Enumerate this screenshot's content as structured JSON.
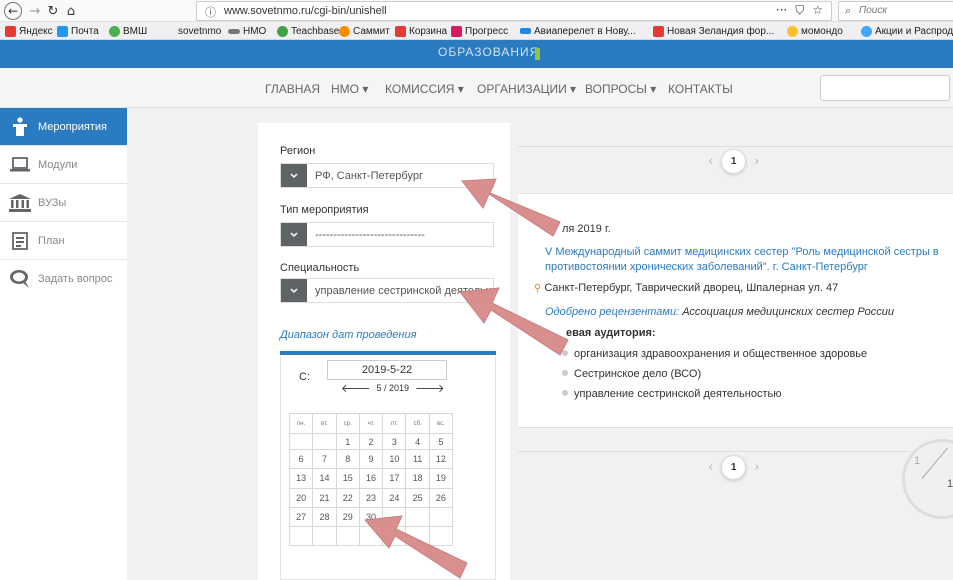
{
  "browser": {
    "url": "www.sovetnmo.ru/cgi-bin/unishell",
    "search_placeholder": "Поиск",
    "url_more": "···",
    "bookmarks": [
      {
        "label": "Яндекс",
        "color": "#e53935"
      },
      {
        "label": "Почта",
        "color": "#2196f3"
      },
      {
        "label": "ВМШ",
        "color": "#4caf50"
      },
      {
        "label": "sovetnmo",
        "color": ""
      },
      {
        "label": "НМО",
        "color": "#555555"
      },
      {
        "label": "Teachbase",
        "color": "#43a047"
      },
      {
        "label": "Саммит",
        "color": "#fb8c00"
      },
      {
        "label": "Корзина",
        "color": "#e53935"
      },
      {
        "label": "Прогресс",
        "color": "#d81b60"
      },
      {
        "label": "Авиаперелет в Нову...",
        "color": "#1e88e5"
      },
      {
        "label": "Новая Зеландия фор...",
        "color": "#e53935"
      },
      {
        "label": "момондо",
        "color": "#fbc02d"
      },
      {
        "label": "Акции и Распродажи",
        "color": "#42a5f5"
      }
    ]
  },
  "site": {
    "top_text": "ОБРАЗОВАНИЯ",
    "nav": [
      {
        "label": "ГЛАВНАЯ"
      },
      {
        "label": "НМО ▾"
      },
      {
        "label": "КОМИССИЯ ▾"
      },
      {
        "label": "ОРГАНИЗАЦИИ ▾"
      },
      {
        "label": "ВОПРОСЫ ▾"
      },
      {
        "label": "КОНТАКТЫ"
      }
    ]
  },
  "sidebar": {
    "items": [
      {
        "label": "Мероприятия",
        "icon": "person-podium-icon",
        "active": true
      },
      {
        "label": "Модули",
        "icon": "laptop-icon",
        "active": false
      },
      {
        "label": "ВУЗы",
        "icon": "university-icon",
        "active": false
      },
      {
        "label": "План",
        "icon": "document-icon",
        "active": false
      },
      {
        "label": "Задать вопрос",
        "icon": "chat-icon",
        "active": false
      }
    ]
  },
  "filters": {
    "region_label": "Регион",
    "region_value": "РФ, Санкт-Петербург",
    "type_label": "Тип мероприятия",
    "type_value": "------------------------------",
    "specialty_label": "Специальность",
    "specialty_value": "управление сестринской деятельностью",
    "date_range_label": "Диапазон дат проведения",
    "from_label": "С:",
    "from_value": "2019-5-22",
    "month_label": "5 / 2019",
    "weekdays": [
      "пн.",
      "вт.",
      "ср.",
      "чт.",
      "пт.",
      "сб.",
      "вс."
    ],
    "weeks": [
      [
        "",
        "",
        "1",
        "2",
        "3",
        "4",
        "5"
      ],
      [
        "6",
        "7",
        "8",
        "9",
        "10",
        "11",
        "12"
      ],
      [
        "13",
        "14",
        "15",
        "16",
        "17",
        "18",
        "19"
      ],
      [
        "20",
        "21",
        "22",
        "23",
        "24",
        "25",
        "26"
      ],
      [
        "27",
        "28",
        "29",
        "30",
        "",
        "",
        ""
      ],
      [
        "",
        "",
        "",
        "",
        "",
        "",
        ""
      ]
    ]
  },
  "pager": {
    "current": "1"
  },
  "event": {
    "date": "ля 2019 г.",
    "title": "V Международный саммит медицинских сестер \"Роль медицинской сестры в противостоянии хронических заболеваний\". г. Санкт-Петербург",
    "location": "Санкт-Петербург, Таврический дворец, Шпалерная ул. 47",
    "approved_label": "Одобрено рецензентами:",
    "approved_value": "Ассоциация медицинских сестер России",
    "audience_title": "евая аудитория:",
    "audience": [
      "организация здравоохранения и общественное здоровье",
      "Сестринское дело (ВСО)",
      "управление сестринской деятельностью"
    ]
  },
  "dial": {
    "a": "1",
    "b": "1"
  },
  "colors": {
    "primary": "#2b7bc0",
    "arrow": "#d98a8a"
  }
}
